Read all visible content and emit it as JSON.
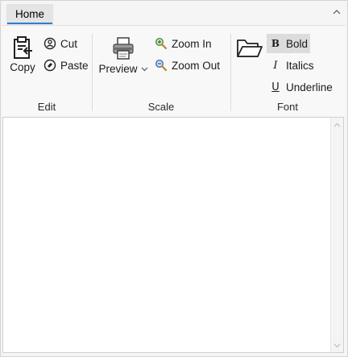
{
  "tabs": [
    {
      "label": "Home",
      "selected": true
    }
  ],
  "accent_color": "#2a7fd6",
  "groups": {
    "edit": {
      "label": "Edit",
      "copy": {
        "label": "Copy",
        "icon": "clipboard-paste-icon"
      },
      "cut": {
        "label": "Cut",
        "icon": "scissors-icon"
      },
      "paste": {
        "label": "Paste",
        "icon": "paste-icon"
      }
    },
    "scale": {
      "label": "Scale",
      "preview": {
        "label": "Preview",
        "icon": "printer-icon",
        "has_dropdown": true
      },
      "zoom_in": {
        "label": "Zoom In",
        "icon": "zoom-in-icon"
      },
      "zoom_out": {
        "label": "Zoom Out",
        "icon": "zoom-out-icon"
      }
    },
    "font": {
      "label": "Font",
      "open": {
        "icon": "folder-open-icon"
      },
      "bold": {
        "label": "Bold",
        "glyph": "B",
        "active": true
      },
      "italics": {
        "label": "Italics",
        "glyph": "I"
      },
      "underline": {
        "label": "Underline",
        "glyph": "U"
      }
    }
  }
}
